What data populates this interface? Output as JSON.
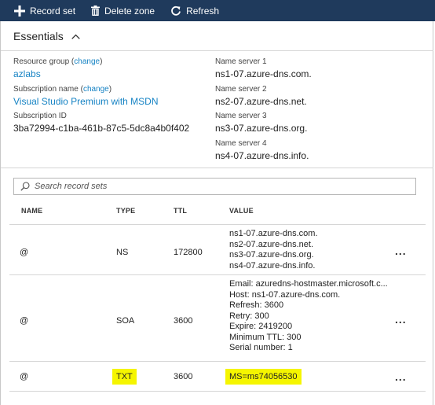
{
  "toolbar": {
    "record_set_label": "Record set",
    "delete_zone_label": "Delete zone",
    "refresh_label": "Refresh",
    "background_color": "#1f3a5c"
  },
  "essentials": {
    "title": "Essentials",
    "resource_group_label": "Resource group",
    "resource_group_change": "change",
    "resource_group_value": "azlabs",
    "subscription_name_label": "Subscription name",
    "subscription_name_change": "change",
    "subscription_name_value": "Visual Studio Premium with MSDN",
    "subscription_id_label": "Subscription ID",
    "subscription_id_value": "3ba72994-c1ba-461b-87c5-5dc8a4b0f402",
    "name_servers": [
      {
        "label": "Name server 1",
        "value": "ns1-07.azure-dns.com."
      },
      {
        "label": "Name server 2",
        "value": "ns2-07.azure-dns.net."
      },
      {
        "label": "Name server 3",
        "value": "ns3-07.azure-dns.org."
      },
      {
        "label": "Name server 4",
        "value": "ns4-07.azure-dns.info."
      }
    ]
  },
  "search": {
    "placeholder": "Search record sets"
  },
  "table": {
    "columns": [
      "NAME",
      "TYPE",
      "TTL",
      "VALUE"
    ],
    "rows": [
      {
        "name": "@",
        "type": "NS",
        "ttl": "172800",
        "values": [
          "ns1-07.azure-dns.com.",
          "ns2-07.azure-dns.net.",
          "ns3-07.azure-dns.org.",
          "ns4-07.azure-dns.info."
        ]
      },
      {
        "name": "@",
        "type": "SOA",
        "ttl": "3600",
        "values": [
          "Email: azuredns-hostmaster.microsoft.c...",
          "Host: ns1-07.azure-dns.com.",
          "Refresh: 3600",
          "Retry: 300",
          "Expire: 2419200",
          "Minimum TTL: 300",
          "Serial number: 1"
        ]
      },
      {
        "name": "@",
        "type": "TXT",
        "ttl": "3600",
        "values": [
          "MS=ms74056530"
        ]
      }
    ],
    "more_label": "...",
    "highlight_color": "#f5f500"
  }
}
